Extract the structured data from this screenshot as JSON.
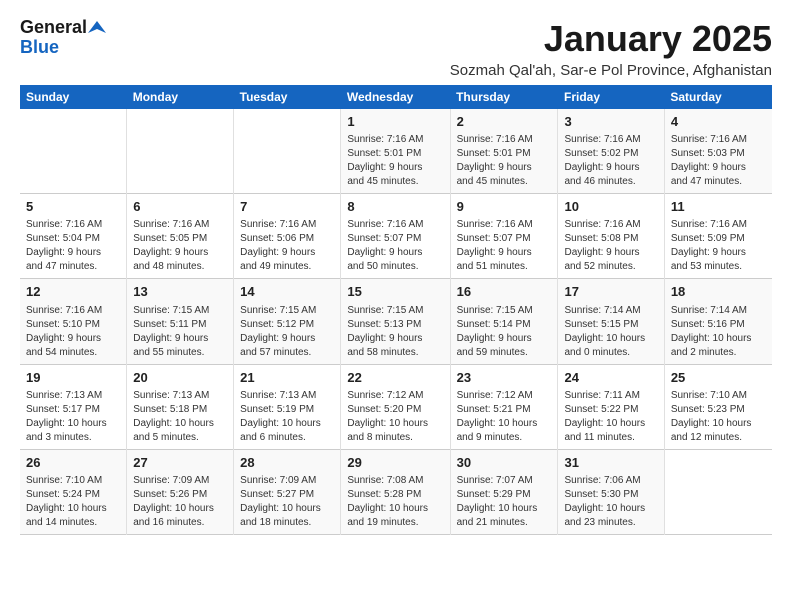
{
  "header": {
    "logo_general": "General",
    "logo_blue": "Blue",
    "month_title": "January 2025",
    "location": "Sozmah Qal'ah, Sar-e Pol Province, Afghanistan"
  },
  "columns": [
    "Sunday",
    "Monday",
    "Tuesday",
    "Wednesday",
    "Thursday",
    "Friday",
    "Saturday"
  ],
  "weeks": [
    [
      {
        "day": "",
        "info": ""
      },
      {
        "day": "",
        "info": ""
      },
      {
        "day": "",
        "info": ""
      },
      {
        "day": "1",
        "info": "Sunrise: 7:16 AM\nSunset: 5:01 PM\nDaylight: 9 hours\nand 45 minutes."
      },
      {
        "day": "2",
        "info": "Sunrise: 7:16 AM\nSunset: 5:01 PM\nDaylight: 9 hours\nand 45 minutes."
      },
      {
        "day": "3",
        "info": "Sunrise: 7:16 AM\nSunset: 5:02 PM\nDaylight: 9 hours\nand 46 minutes."
      },
      {
        "day": "4",
        "info": "Sunrise: 7:16 AM\nSunset: 5:03 PM\nDaylight: 9 hours\nand 47 minutes."
      }
    ],
    [
      {
        "day": "5",
        "info": "Sunrise: 7:16 AM\nSunset: 5:04 PM\nDaylight: 9 hours\nand 47 minutes."
      },
      {
        "day": "6",
        "info": "Sunrise: 7:16 AM\nSunset: 5:05 PM\nDaylight: 9 hours\nand 48 minutes."
      },
      {
        "day": "7",
        "info": "Sunrise: 7:16 AM\nSunset: 5:06 PM\nDaylight: 9 hours\nand 49 minutes."
      },
      {
        "day": "8",
        "info": "Sunrise: 7:16 AM\nSunset: 5:07 PM\nDaylight: 9 hours\nand 50 minutes."
      },
      {
        "day": "9",
        "info": "Sunrise: 7:16 AM\nSunset: 5:07 PM\nDaylight: 9 hours\nand 51 minutes."
      },
      {
        "day": "10",
        "info": "Sunrise: 7:16 AM\nSunset: 5:08 PM\nDaylight: 9 hours\nand 52 minutes."
      },
      {
        "day": "11",
        "info": "Sunrise: 7:16 AM\nSunset: 5:09 PM\nDaylight: 9 hours\nand 53 minutes."
      }
    ],
    [
      {
        "day": "12",
        "info": "Sunrise: 7:16 AM\nSunset: 5:10 PM\nDaylight: 9 hours\nand 54 minutes."
      },
      {
        "day": "13",
        "info": "Sunrise: 7:15 AM\nSunset: 5:11 PM\nDaylight: 9 hours\nand 55 minutes."
      },
      {
        "day": "14",
        "info": "Sunrise: 7:15 AM\nSunset: 5:12 PM\nDaylight: 9 hours\nand 57 minutes."
      },
      {
        "day": "15",
        "info": "Sunrise: 7:15 AM\nSunset: 5:13 PM\nDaylight: 9 hours\nand 58 minutes."
      },
      {
        "day": "16",
        "info": "Sunrise: 7:15 AM\nSunset: 5:14 PM\nDaylight: 9 hours\nand 59 minutes."
      },
      {
        "day": "17",
        "info": "Sunrise: 7:14 AM\nSunset: 5:15 PM\nDaylight: 10 hours\nand 0 minutes."
      },
      {
        "day": "18",
        "info": "Sunrise: 7:14 AM\nSunset: 5:16 PM\nDaylight: 10 hours\nand 2 minutes."
      }
    ],
    [
      {
        "day": "19",
        "info": "Sunrise: 7:13 AM\nSunset: 5:17 PM\nDaylight: 10 hours\nand 3 minutes."
      },
      {
        "day": "20",
        "info": "Sunrise: 7:13 AM\nSunset: 5:18 PM\nDaylight: 10 hours\nand 5 minutes."
      },
      {
        "day": "21",
        "info": "Sunrise: 7:13 AM\nSunset: 5:19 PM\nDaylight: 10 hours\nand 6 minutes."
      },
      {
        "day": "22",
        "info": "Sunrise: 7:12 AM\nSunset: 5:20 PM\nDaylight: 10 hours\nand 8 minutes."
      },
      {
        "day": "23",
        "info": "Sunrise: 7:12 AM\nSunset: 5:21 PM\nDaylight: 10 hours\nand 9 minutes."
      },
      {
        "day": "24",
        "info": "Sunrise: 7:11 AM\nSunset: 5:22 PM\nDaylight: 10 hours\nand 11 minutes."
      },
      {
        "day": "25",
        "info": "Sunrise: 7:10 AM\nSunset: 5:23 PM\nDaylight: 10 hours\nand 12 minutes."
      }
    ],
    [
      {
        "day": "26",
        "info": "Sunrise: 7:10 AM\nSunset: 5:24 PM\nDaylight: 10 hours\nand 14 minutes."
      },
      {
        "day": "27",
        "info": "Sunrise: 7:09 AM\nSunset: 5:26 PM\nDaylight: 10 hours\nand 16 minutes."
      },
      {
        "day": "28",
        "info": "Sunrise: 7:09 AM\nSunset: 5:27 PM\nDaylight: 10 hours\nand 18 minutes."
      },
      {
        "day": "29",
        "info": "Sunrise: 7:08 AM\nSunset: 5:28 PM\nDaylight: 10 hours\nand 19 minutes."
      },
      {
        "day": "30",
        "info": "Sunrise: 7:07 AM\nSunset: 5:29 PM\nDaylight: 10 hours\nand 21 minutes."
      },
      {
        "day": "31",
        "info": "Sunrise: 7:06 AM\nSunset: 5:30 PM\nDaylight: 10 hours\nand 23 minutes."
      },
      {
        "day": "",
        "info": ""
      }
    ]
  ]
}
